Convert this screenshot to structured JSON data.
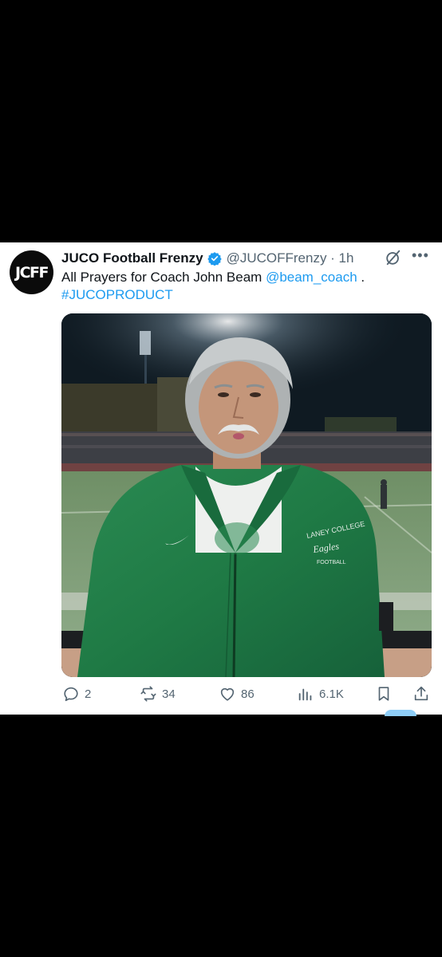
{
  "tweet": {
    "avatar_text": "JCFF",
    "display_name": "JUCO Football Frenzy",
    "handle_time": "@JUCOFFrenzy · 1h",
    "text_plain": "All Prayers for Coach John Beam ",
    "mention": "@beam_coach",
    "text_end": " .",
    "hashtag": "#JUCOPRODUCT",
    "photo": {
      "jacket_text_1": "LANEY COLLEGE",
      "jacket_text_2": "Eagles",
      "jacket_text_3": "FOOTBALL"
    }
  },
  "actions": {
    "replies": "2",
    "reposts": "34",
    "likes": "86",
    "views": "6.1K"
  },
  "colors": {
    "accent": "#1d9bf0",
    "secondary_text": "#536471",
    "primary_text": "#0f1419",
    "jacket_green": "#1f7a45"
  },
  "icons": [
    "grok-icon",
    "more-icon",
    "verified-badge-icon",
    "reply-icon",
    "repost-icon",
    "like-icon",
    "views-icon",
    "bookmark-icon",
    "share-icon"
  ]
}
